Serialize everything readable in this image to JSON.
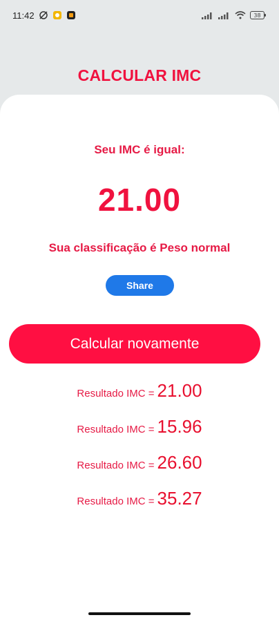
{
  "status_bar": {
    "time": "11:42",
    "battery": "38"
  },
  "app": {
    "title": "CALCULAR IMC"
  },
  "result": {
    "label": "Seu IMC é igual:",
    "value": "21.00",
    "classification": "Sua classificação é Peso normal"
  },
  "buttons": {
    "share_label": "Share",
    "recalc_label": "Calcular novamente"
  },
  "history": [
    {
      "prefix": "Resultado IMC =",
      "value": "21.00"
    },
    {
      "prefix": "Resultado IMC =",
      "value": "15.96"
    },
    {
      "prefix": "Resultado IMC =",
      "value": "26.60"
    },
    {
      "prefix": "Resultado IMC =",
      "value": "35.27"
    }
  ],
  "colors": {
    "accent": "#f0123f",
    "share_button": "#1f79e8",
    "background": "#e6e9ea",
    "card": "#ffffff"
  },
  "icons": [
    "sync-off-icon",
    "notification-icon",
    "app-icon",
    "signal-icon",
    "signal-icon",
    "wifi-icon",
    "battery-icon"
  ]
}
